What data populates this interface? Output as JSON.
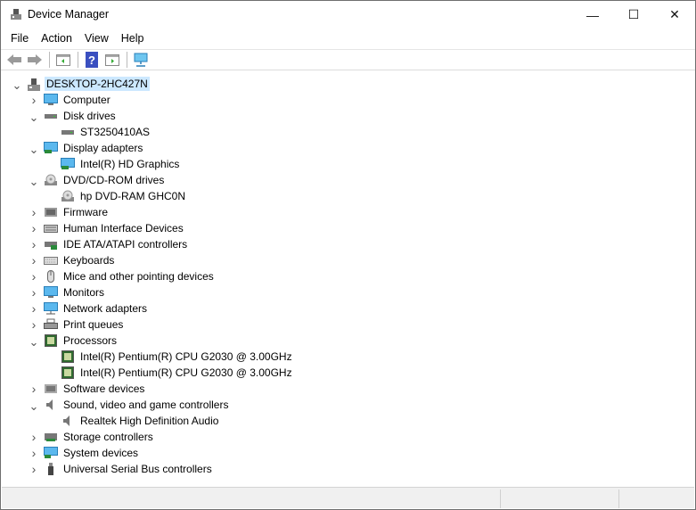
{
  "window": {
    "title": "Device Manager",
    "minimize": "—",
    "maximize": "☐",
    "close": "✕"
  },
  "menu": [
    "File",
    "Action",
    "View",
    "Help"
  ],
  "toolbar": [
    "back-icon",
    "forward-icon",
    "properties-icon",
    "help-icon",
    "update-driver-icon",
    "scan-hardware-icon"
  ],
  "tree": [
    {
      "label": "DESKTOP-2HC427N",
      "level": 0,
      "state": "expanded",
      "icon": "computer-tower-icon",
      "selected": true
    },
    {
      "label": "Computer",
      "level": 1,
      "state": "collapsed",
      "icon": "monitor-icon"
    },
    {
      "label": "Disk drives",
      "level": 1,
      "state": "expanded",
      "icon": "disk-icon"
    },
    {
      "label": "ST3250410AS",
      "level": 2,
      "icon": "disk-icon"
    },
    {
      "label": "Display adapters",
      "level": 1,
      "state": "expanded",
      "icon": "display-adapter-icon"
    },
    {
      "label": "Intel(R) HD Graphics",
      "level": 2,
      "icon": "display-adapter-icon"
    },
    {
      "label": "DVD/CD-ROM drives",
      "level": 1,
      "state": "expanded",
      "icon": "dvd-icon"
    },
    {
      "label": "hp DVD-RAM GHC0N",
      "level": 2,
      "icon": "dvd-icon"
    },
    {
      "label": "Firmware",
      "level": 1,
      "state": "collapsed",
      "icon": "firmware-icon"
    },
    {
      "label": "Human Interface Devices",
      "level": 1,
      "state": "collapsed",
      "icon": "hid-icon"
    },
    {
      "label": "IDE ATA/ATAPI controllers",
      "level": 1,
      "state": "collapsed",
      "icon": "ide-icon"
    },
    {
      "label": "Keyboards",
      "level": 1,
      "state": "collapsed",
      "icon": "keyboard-icon"
    },
    {
      "label": "Mice and other pointing devices",
      "level": 1,
      "state": "collapsed",
      "icon": "mouse-icon"
    },
    {
      "label": "Monitors",
      "level": 1,
      "state": "collapsed",
      "icon": "monitor-icon"
    },
    {
      "label": "Network adapters",
      "level": 1,
      "state": "collapsed",
      "icon": "network-icon"
    },
    {
      "label": "Print queues",
      "level": 1,
      "state": "collapsed",
      "icon": "printer-icon"
    },
    {
      "label": "Processors",
      "level": 1,
      "state": "expanded",
      "icon": "processor-icon"
    },
    {
      "label": "Intel(R) Pentium(R) CPU G2030 @ 3.00GHz",
      "level": 2,
      "icon": "processor-icon"
    },
    {
      "label": "Intel(R) Pentium(R) CPU G2030 @ 3.00GHz",
      "level": 2,
      "icon": "processor-icon"
    },
    {
      "label": "Software devices",
      "level": 1,
      "state": "collapsed",
      "icon": "software-icon"
    },
    {
      "label": "Sound, video and game controllers",
      "level": 1,
      "state": "expanded",
      "icon": "speaker-icon"
    },
    {
      "label": "Realtek High Definition Audio",
      "level": 2,
      "icon": "speaker-icon"
    },
    {
      "label": "Storage controllers",
      "level": 1,
      "state": "collapsed",
      "icon": "storage-icon"
    },
    {
      "label": "System devices",
      "level": 1,
      "state": "collapsed",
      "icon": "system-icon"
    },
    {
      "label": "Universal Serial Bus controllers",
      "level": 1,
      "state": "collapsed",
      "icon": "usb-icon"
    }
  ]
}
